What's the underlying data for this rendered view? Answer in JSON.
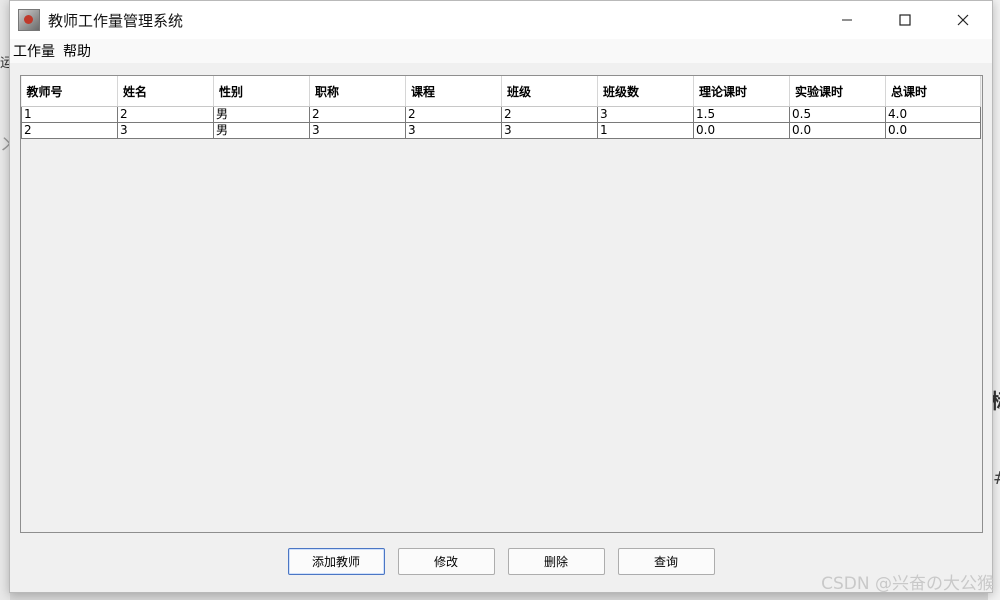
{
  "background": {
    "left_text": "运",
    "right_text_1": "标",
    "right_text_2": "#",
    "left_text_2": "ㄨ"
  },
  "window": {
    "title": "教师工作量管理系统"
  },
  "menu": {
    "items": [
      "工作量",
      "帮助"
    ]
  },
  "table": {
    "columns": [
      "教师号",
      "姓名",
      "性别",
      "职称",
      "课程",
      "班级",
      "班级数",
      "理论课时",
      "实验课时",
      "总课时"
    ],
    "rows": [
      [
        "1",
        "2",
        "男",
        "2",
        "2",
        "2",
        "3",
        "1.5",
        "0.5",
        "4.0"
      ],
      [
        "2",
        "3",
        "男",
        "3",
        "3",
        "3",
        "1",
        "0.0",
        "0.0",
        "0.0"
      ]
    ]
  },
  "buttons": {
    "add": "添加教师",
    "edit": "修改",
    "delete": "删除",
    "query": "查询"
  },
  "watermark": "CSDN @兴奋の大公猴",
  "colors": {
    "window_bg": "#f0f0f0",
    "focus_border": "#4b76c4"
  }
}
